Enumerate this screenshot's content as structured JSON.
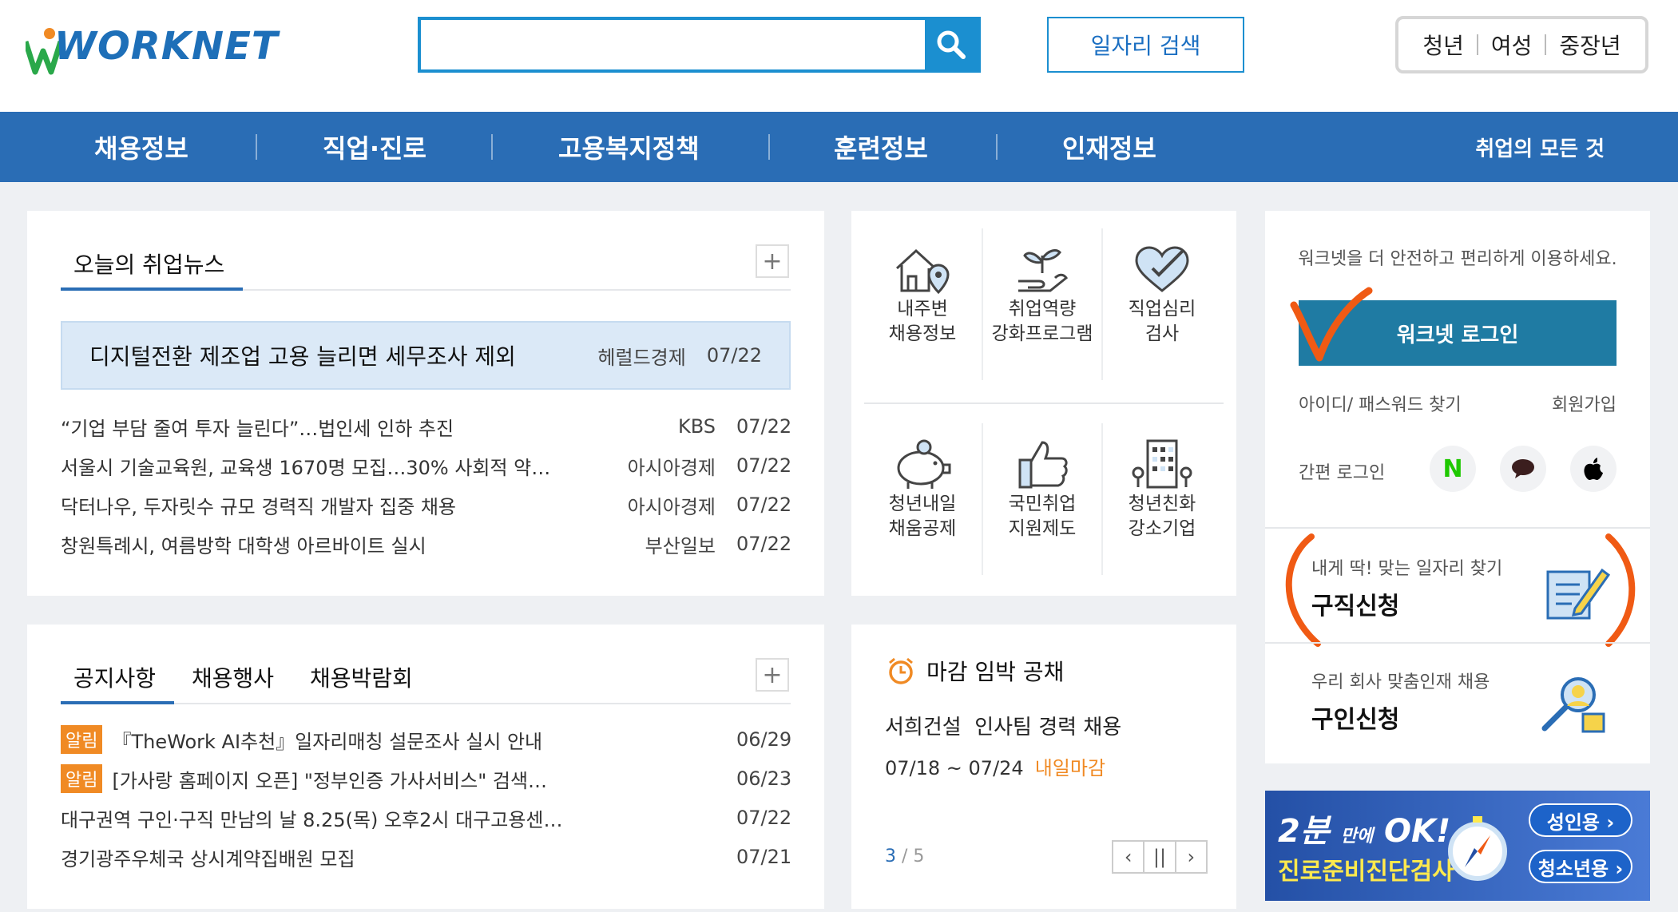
{
  "header": {
    "logo": "WORKNET",
    "search_placeholder": "",
    "search_button": "일자리 검색",
    "age_groups": [
      "청년",
      "여성",
      "중장년"
    ]
  },
  "nav": {
    "items": [
      "채용정보",
      "직업·진로",
      "고용복지정책",
      "훈련정보",
      "인재정보"
    ],
    "all": "취업의 모든 것"
  },
  "news": {
    "tab": "오늘의 취업뉴스",
    "plus": "+",
    "headline": {
      "title": "디지털전환 제조업 고용 늘리면 세무조사 제외",
      "source": "헤럴드경제",
      "date": "07/22"
    },
    "items": [
      {
        "title": "“기업 부담 줄여 투자 늘린다”…법인세 인하 추진",
        "source": "KBS",
        "date": "07/22"
      },
      {
        "title": "서울시 기술교육원, 교육생 1670명 모집…30% 사회적 약…",
        "source": "아시아경제",
        "date": "07/22"
      },
      {
        "title": "닥터나우, 두자릿수 규모 경력직 개발자 집중 채용",
        "source": "아시아경제",
        "date": "07/22"
      },
      {
        "title": "창원특례시, 여름방학 대학생 아르바이트 실시",
        "source": "부산일보",
        "date": "07/22"
      }
    ]
  },
  "notice": {
    "tabs": [
      "공지사항",
      "채용행사",
      "채용박람회"
    ],
    "plus": "+",
    "tag": "알림",
    "items": [
      {
        "tag": "알림",
        "title": "『TheWork AI추천』일자리매칭 설문조사 실시 안내",
        "date": "06/29"
      },
      {
        "tag": "알림",
        "title": "[가사랑 홈페이지 오픈] \"정부인증 가사서비스\" 검색…",
        "date": "06/23"
      },
      {
        "tag": "",
        "title": "대구권역 구인·구직 만남의 날 8.25(목) 오후2시 대구고용센…",
        "date": "07/22"
      },
      {
        "tag": "",
        "title": "경기광주우체국 상시계약집배원 모집",
        "date": "07/21"
      }
    ]
  },
  "services": [
    {
      "line1": "내주변",
      "line2": "채용정보",
      "icon": "house-location-icon"
    },
    {
      "line1": "취업역량",
      "line2": "강화프로그램",
      "icon": "sprout-hand-icon"
    },
    {
      "line1": "직업심리",
      "line2": "검사",
      "icon": "heart-pen-icon"
    },
    {
      "line1": "청년내일",
      "line2": "채움공제",
      "icon": "piggy-bank-icon"
    },
    {
      "line1": "국민취업",
      "line2": "지원제도",
      "icon": "thumbs-up-icon"
    },
    {
      "line1": "청년친화",
      "line2": "강소기업",
      "icon": "building-icon"
    }
  ],
  "deadline": {
    "title": "마감 임박 공채",
    "company": "서희건설  인사팀 경력 채용",
    "period": "07/18 ~ 07/24",
    "badge": "내일마감",
    "page_current": "3",
    "page_total": "/ 5",
    "controls": [
      "‹",
      "||",
      "›"
    ]
  },
  "login": {
    "message": "워크넷을 더 안전하고 편리하게 이용하세요.",
    "button": "워크넷 로그인",
    "find_id": "아이디/ 패스워드 찾기",
    "join": "회원가입",
    "easy_login": "간편 로그인",
    "sns": [
      "N"
    ],
    "job_seek": {
      "sub": "내게 딱! 맞는 일자리 찾기",
      "title": "구직신청"
    },
    "job_offer": {
      "sub": "우리 회사 맞춤인재 채용",
      "title": "구인신청"
    }
  },
  "banner": {
    "main": "2분",
    "small": "만에",
    "ok": "OK!",
    "sub": "진로준비진단검사",
    "btn1": "성인용 ›",
    "btn2": "청소년용 ›"
  },
  "colors": {
    "brand_blue": "#2a6db5",
    "search_blue": "#1b8fd0",
    "login_teal": "#1f7ba3",
    "accent_orange": "#f08a24",
    "annotation_orange": "#f05a14"
  }
}
